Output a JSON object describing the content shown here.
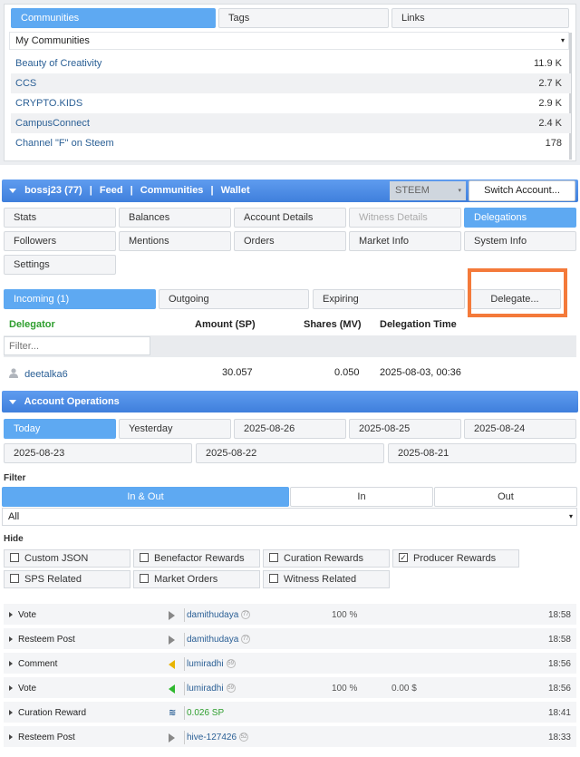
{
  "top_tabs": [
    "Communities",
    "Tags",
    "Links"
  ],
  "my_communities_select": "My Communities",
  "communities": [
    {
      "name": "Beauty of Creativity",
      "count": "11.9 K"
    },
    {
      "name": "CCS",
      "count": "2.7 K"
    },
    {
      "name": "CRYPTO.KIDS",
      "count": "2.9 K"
    },
    {
      "name": "CampusConnect",
      "count": "2.4 K"
    },
    {
      "name": "Channel \"F\" on Steem",
      "count": "178"
    }
  ],
  "account_bar": {
    "user": "bossj23 (77)",
    "sep": "|",
    "feed": "Feed",
    "communities": "Communities",
    "wallet": "Wallet",
    "currency": "STEEM",
    "switch": "Switch Account..."
  },
  "nav_tabs": {
    "stats": "Stats",
    "balances": "Balances",
    "account_details": "Account Details",
    "witness_details": "Witness Details",
    "delegations": "Delegations",
    "followers": "Followers",
    "mentions": "Mentions",
    "orders": "Orders",
    "market_info": "Market Info",
    "system_info": "System Info",
    "settings": "Settings"
  },
  "delegation_tabs": {
    "incoming": "Incoming (1)",
    "outgoing": "Outgoing",
    "expiring": "Expiring",
    "delegate": "Delegate..."
  },
  "delegation_table": {
    "headers": {
      "delegator": "Delegator",
      "amount": "Amount (SP)",
      "shares": "Shares (MV)",
      "time": "Delegation Time"
    },
    "filter_placeholder": "Filter...",
    "rows": [
      {
        "delegator": "deetalka6",
        "amount": "30.057",
        "shares": "0.050",
        "time": "2025-08-03, 00:36"
      }
    ]
  },
  "account_operations": {
    "title": "Account Operations",
    "dates_row1": [
      "Today",
      "Yesterday",
      "2025-08-26",
      "2025-08-25",
      "2025-08-24"
    ],
    "dates_row2": [
      "2025-08-23",
      "2025-08-22",
      "2025-08-21"
    ],
    "filter_label": "Filter",
    "direction": [
      "In & Out",
      "In",
      "Out"
    ],
    "type_select": "All",
    "hide_label": "Hide",
    "hide_options": [
      {
        "label": "Custom JSON",
        "checked": false
      },
      {
        "label": "Benefactor Rewards",
        "checked": false
      },
      {
        "label": "Curation Rewards",
        "checked": false
      },
      {
        "label": "Producer Rewards",
        "checked": true
      },
      {
        "label": "SPS Related",
        "checked": false
      },
      {
        "label": "Market Orders",
        "checked": false
      },
      {
        "label": "Witness Related",
        "checked": false
      }
    ],
    "checkmark": "✓",
    "operations": [
      {
        "type": "Vote",
        "icon_color": "#888888",
        "user": "damithudaya",
        "rep": "77",
        "pct": "100 %",
        "usd": "",
        "time": "18:58"
      },
      {
        "type": "Resteem Post",
        "icon_color": "#888888",
        "user": "damithudaya",
        "rep": "77",
        "pct": "",
        "usd": "",
        "time": "18:58"
      },
      {
        "type": "Comment",
        "icon_color": "#e8b400",
        "user": "lumiradhi",
        "rep": "59",
        "pct": "",
        "usd": "",
        "time": "18:56"
      },
      {
        "type": "Vote",
        "icon_color": "#2eb82e",
        "user": "lumiradhi",
        "rep": "59",
        "pct": "100 %",
        "usd": "0.00 $",
        "time": "18:56"
      },
      {
        "type": "Curation Reward",
        "icon_color": "#2a5f95",
        "user": "0.026 SP",
        "rep": "",
        "pct": "",
        "usd": "",
        "time": "18:41"
      },
      {
        "type": "Resteem Post",
        "icon_color": "#888888",
        "user": "hive-127426",
        "rep": "52",
        "pct": "",
        "usd": "",
        "time": "18:33"
      }
    ]
  },
  "colors": {
    "accent": "#5ea9f2",
    "bar": "#3f7fdc",
    "highlight_box": "#f47a3a",
    "link": "#2a5f95",
    "delegator_header": "#2e9e2e"
  }
}
